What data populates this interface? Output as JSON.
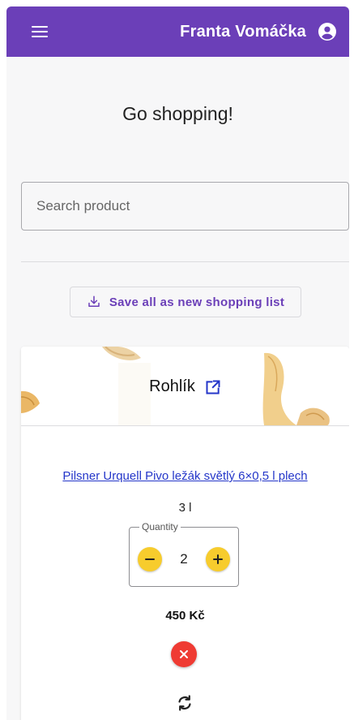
{
  "header": {
    "user_name": "Franta Vomáčka",
    "brand_color": "#6b3fb8",
    "menu_icon": "menu-icon",
    "account_icon": "account-circle-icon"
  },
  "page": {
    "title": "Go shopping!"
  },
  "search": {
    "placeholder": "Search product",
    "value": ""
  },
  "actions": {
    "save_label": "Save all as new shopping list",
    "save_icon": "download-icon"
  },
  "card": {
    "title": "Rohlík",
    "open_icon": "open-in-new-icon",
    "product_name": "Pilsner Urquell Pivo ležák světlý 6×0,5 l plech",
    "unit": "3 l",
    "quantity_label": "Quantity",
    "quantity": "2",
    "price": "450 Kč",
    "minus_icon": "minus-icon",
    "plus_icon": "plus-icon",
    "remove_icon": "close-icon",
    "refresh_icon": "refresh-icon",
    "accent_yellow": "#f7cc2d",
    "accent_red": "#ef3b33"
  }
}
